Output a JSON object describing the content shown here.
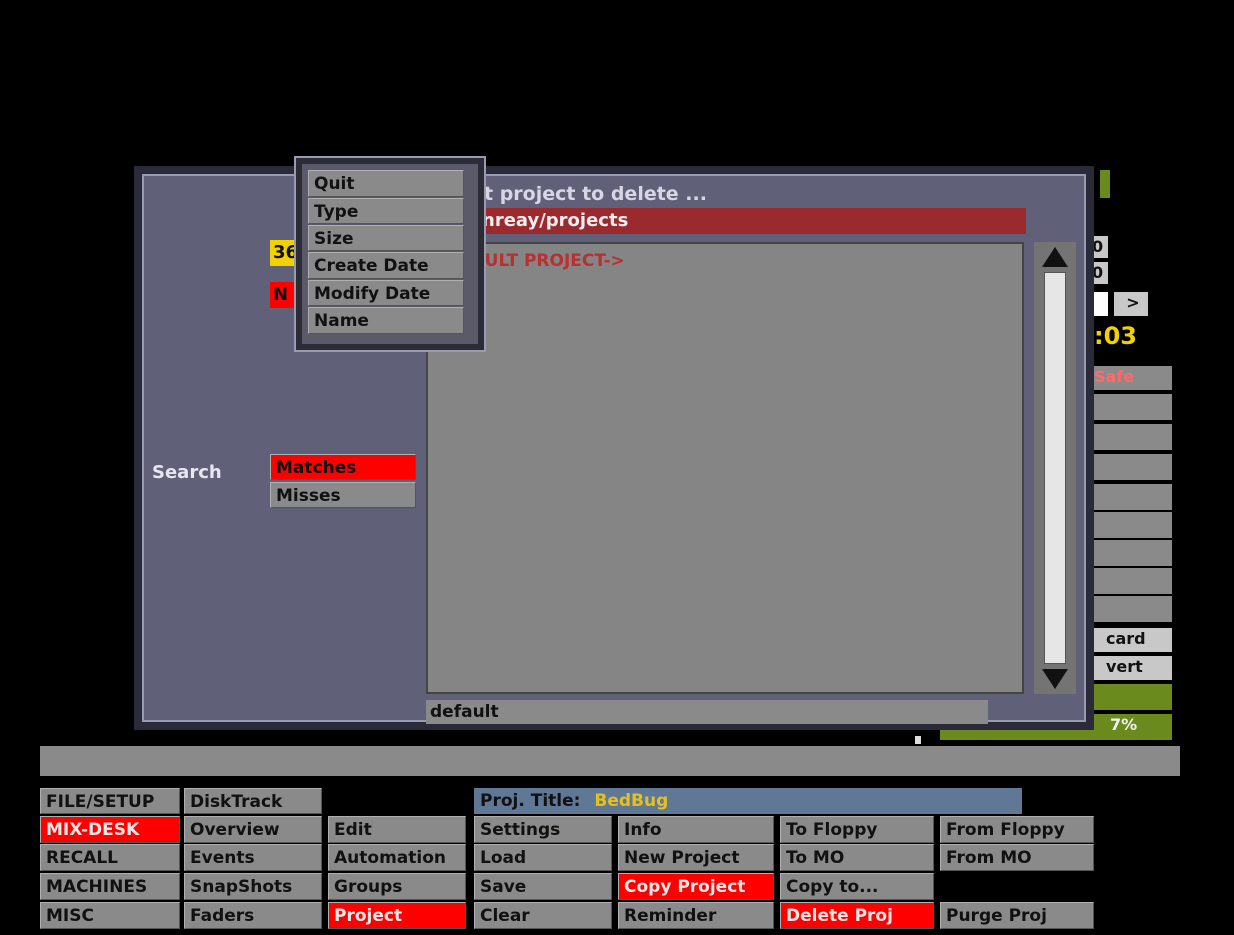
{
  "dialog": {
    "title": "t project to delete ...",
    "path": "nreay/projects",
    "list_items": [
      "AULT PROJECT->"
    ],
    "name_field": "default",
    "left_badge_yellow": "36",
    "left_badge_red": "N",
    "search_label": "Search",
    "search_options": [
      "Matches",
      "Misses"
    ]
  },
  "sort_menu": {
    "items": [
      "Quit",
      "Type",
      "Size",
      "Create Date",
      "Modify Date",
      "Name"
    ]
  },
  "right_panel": {
    "row1": "0",
    "row2": "0",
    "nav_right": ">",
    "time": ":03",
    "safe_label": "Safe",
    "card_label": "card",
    "vert_label": "vert",
    "percent_label": "7%"
  },
  "menu": {
    "col1": [
      "FILE/SETUP",
      "MIX-DESK",
      "RECALL",
      "MACHINES",
      "MISC"
    ],
    "col2": [
      "DiskTrack",
      "Overview",
      "Events",
      "SnapShots",
      "Faders"
    ],
    "col3": [
      "Edit",
      "Automation",
      "Groups",
      "Project"
    ],
    "proj_title_label": "Proj. Title:",
    "proj_title_value": "BedBug",
    "col4": [
      "Settings",
      "Load",
      "Save",
      "Clear"
    ],
    "col5": [
      "Info",
      "New Project",
      "Copy Project",
      "Reminder"
    ],
    "col6": [
      "To Floppy",
      "To MO",
      "Copy to...",
      "Delete Proj"
    ],
    "col7": [
      "From Floppy",
      "From MO",
      "Purge Proj"
    ]
  },
  "colors": {
    "active_red": "#ff0000",
    "dialog_bg": "#606078",
    "button_gray": "#8a8a8a",
    "title_bar_blue": "#5e7896",
    "title_value_yellow": "#e6c020",
    "accent_green": "#6b8a1e"
  }
}
